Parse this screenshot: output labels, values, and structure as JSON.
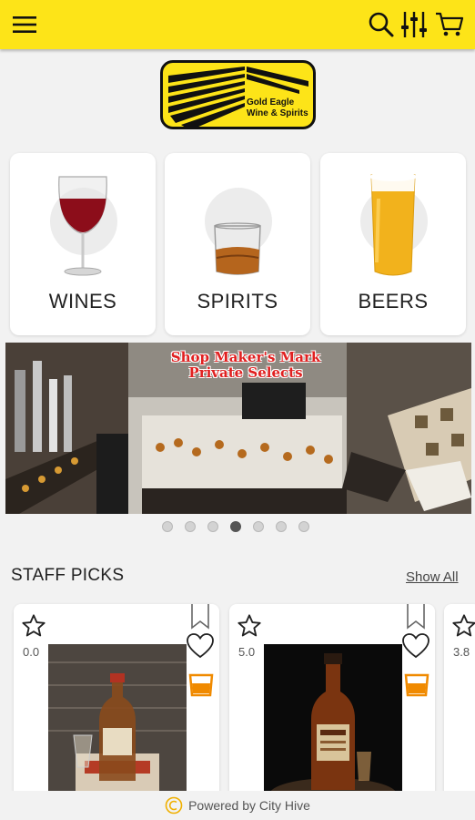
{
  "header": {
    "menu_icon": "hamburger-menu-icon",
    "search_icon": "search-icon",
    "filter_icon": "filter-sliders-icon",
    "cart_icon": "shopping-cart-icon",
    "background_color": "#fde418"
  },
  "logo": {
    "line1": "Gold Eagle",
    "line2": "Wine & Spirits"
  },
  "categories": [
    {
      "label": "WINES",
      "icon": "wine-glass"
    },
    {
      "label": "SPIRITS",
      "icon": "whiskey-glass"
    },
    {
      "label": "BEERS",
      "icon": "beer-glass"
    }
  ],
  "banner": {
    "title_line1": "Shop Maker's Mark",
    "title_line2": "Private Selects"
  },
  "carousel": {
    "total": 7,
    "active_index": 3
  },
  "staff_picks": {
    "title": "STAFF PICKS",
    "show_all_label": "Show All",
    "products": [
      {
        "rating": "0.0"
      },
      {
        "rating": "5.0"
      },
      {
        "rating": "3.8"
      }
    ]
  },
  "footer": {
    "powered_by": "Powered by City Hive"
  },
  "colors": {
    "accent_yellow": "#fde418",
    "glass_orange": "#f08a00",
    "active_dot": "#555555"
  }
}
